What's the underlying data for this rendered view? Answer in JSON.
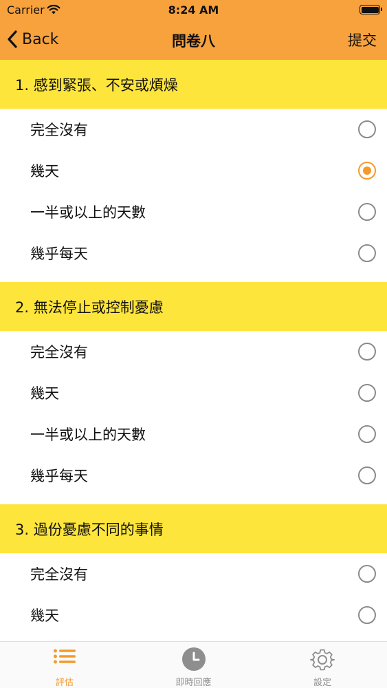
{
  "status_bar": {
    "carrier": "Carrier",
    "time": "8:24 AM"
  },
  "nav": {
    "back_label": "Back",
    "title": "問卷八",
    "submit_label": "提交"
  },
  "colors": {
    "accent": "#F39A2B",
    "nav_bg": "#F8A23D",
    "section_bg": "#FEE53C"
  },
  "questions": [
    {
      "title": "1. 感到緊張、不安或煩燥",
      "options": [
        {
          "label": "完全沒有",
          "selected": false
        },
        {
          "label": "幾天",
          "selected": true
        },
        {
          "label": "一半或以上的天數",
          "selected": false
        },
        {
          "label": "幾乎每天",
          "selected": false
        }
      ]
    },
    {
      "title": "2. 無法停止或控制憂慮",
      "options": [
        {
          "label": "完全沒有",
          "selected": false
        },
        {
          "label": "幾天",
          "selected": false
        },
        {
          "label": "一半或以上的天數",
          "selected": false
        },
        {
          "label": "幾乎每天",
          "selected": false
        }
      ]
    },
    {
      "title": "3. 過份憂慮不同的事情",
      "options": [
        {
          "label": "完全沒有",
          "selected": false
        },
        {
          "label": "幾天",
          "selected": false
        }
      ]
    }
  ],
  "tabs": [
    {
      "label": "評估",
      "icon": "list-icon",
      "active": true
    },
    {
      "label": "即時回應",
      "icon": "clock-icon",
      "active": false
    },
    {
      "label": "設定",
      "icon": "gear-icon",
      "active": false
    }
  ]
}
